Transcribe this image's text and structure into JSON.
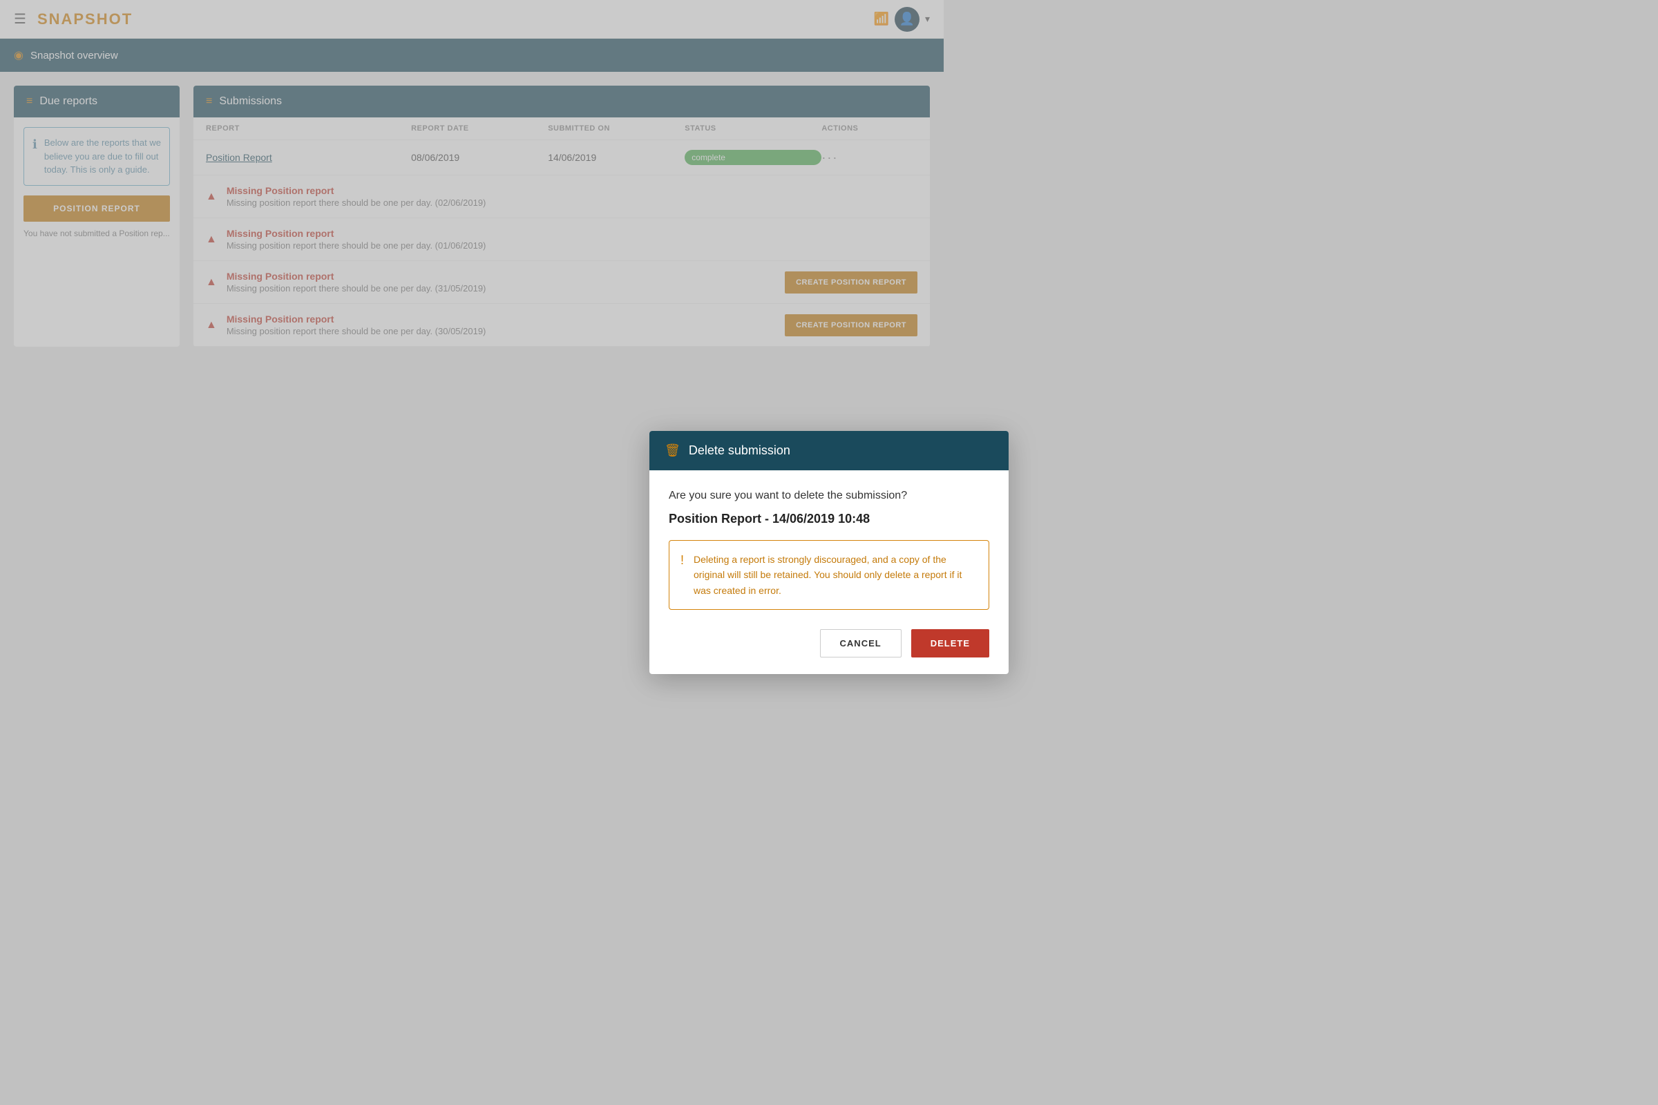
{
  "app": {
    "title": "SNAPSHOT"
  },
  "breadcrumb": {
    "text": "Snapshot overview"
  },
  "due_reports_panel": {
    "title": "Due reports",
    "info_text": "Below are the reports that we believe you are due to fill out today. This is only a guide.",
    "position_report_button": "POSITION REPORT",
    "not_submitted_text": "You have not submitted a Position rep..."
  },
  "submissions_panel": {
    "title": "Submissions",
    "columns": [
      "REPORT",
      "REPORT DATE",
      "SUBMITTED ON",
      "STATUS",
      "ACTIONS"
    ],
    "rows": [
      {
        "report": "Position Report",
        "report_date": "08/06/2019",
        "submitted_on": "14/06/2019",
        "status": "complete",
        "actions": "···"
      }
    ]
  },
  "missing_reports": [
    {
      "title": "Missing Position report",
      "description": "Missing position report there should be one per day. (02/06/2019)",
      "show_button": false
    },
    {
      "title": "Missing Position report",
      "description": "Missing position report there should be one per day. (01/06/2019)",
      "show_button": false
    },
    {
      "title": "Missing Position report",
      "description": "Missing position report there should be one per day. (31/05/2019)",
      "show_button": true,
      "button_label": "CREATE POSITION REPORT"
    },
    {
      "title": "Missing Position report",
      "description": "Missing position report there should be one per day. (30/05/2019)",
      "show_button": true,
      "button_label": "CREATE POSITION REPORT"
    }
  ],
  "modal": {
    "header_title": "Delete submission",
    "question": "Are you sure you want to delete the submission?",
    "submission_name": "Position Report - 14/06/2019 10:48",
    "warning_text": "Deleting a report is strongly discouraged, and a copy of the original will still be retained. You should only delete a report if it was created in error.",
    "cancel_label": "CANCEL",
    "delete_label": "DELETE"
  }
}
